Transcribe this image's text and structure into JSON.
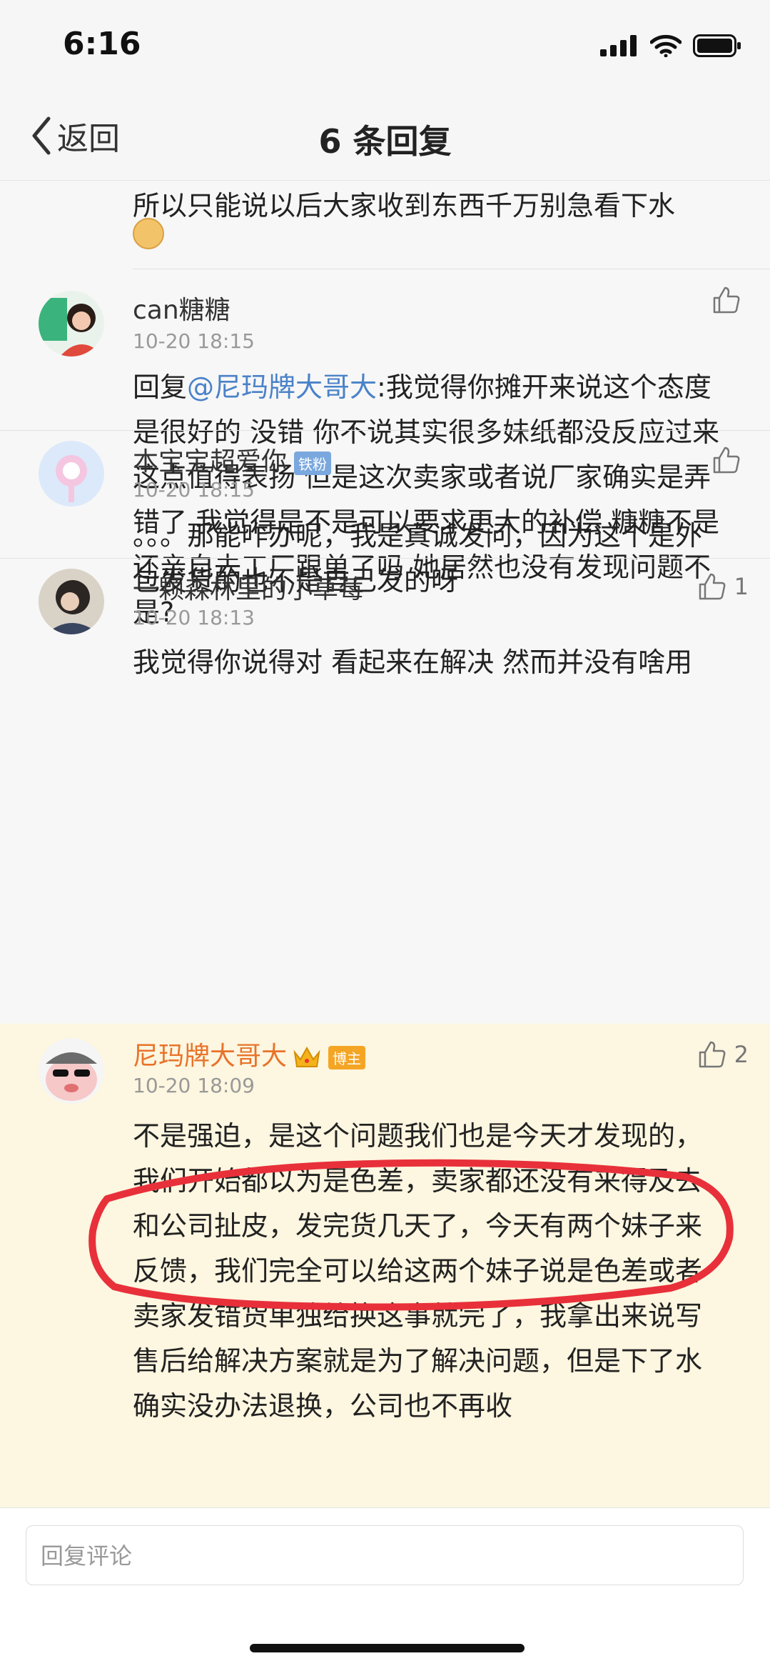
{
  "status": {
    "time": "6:16"
  },
  "nav": {
    "back_label": "返回",
    "title": "6 条回复"
  },
  "continued_text": "所以只能说以后大家收到东西千万别急看下水",
  "comments": [
    {
      "username": "can糖糖",
      "time": "10-20 18:15",
      "text_prefix": "回复",
      "mention": "@尼玛牌大哥大",
      "text": ":我觉得你摊开来说这个态度是很好的 没错 你不说其实很多妹纸都没反应过来 这点值得表扬 但是这次卖家或者说厂家确实是弄错了 我觉得是不是可以要求更大的补偿 糖糖不是还亲自去工厂跟单了吗 她居然也没有发现问题不是?",
      "likes": ""
    },
    {
      "username": "本宝宝超爱你",
      "badge": "铁粉",
      "time": "10-20 18:15",
      "text": "。。。那能咋办呢，我是真诚发问，因为这个是外包发货的也不是自己发的呀",
      "likes": ""
    },
    {
      "username": "一颗森林里的小草莓",
      "time": "10-20 18:13",
      "text": "我觉得你说得对  看起来在解决  然而并没有啥用",
      "likes": "1"
    },
    {
      "username": "尼玛牌大哥大",
      "badge": "博主",
      "time": "10-20 18:09",
      "text": "不是强迫，是这个问题我们也是今天才发现的，我们开始都以为是色差，卖家都还没有来得及去和公司扯皮，发完货几天了，今天有两个妹子来反馈，我们完全可以给这两个妹子说是色差或者卖家发错货单独给换这事就完了，我拿出来说写售后给解决方案就是为了解决问题，但是下了水确实没办法退换，公司也不再收",
      "likes": "2"
    }
  ],
  "reply": {
    "placeholder": "回复评论"
  },
  "colors": {
    "owner_name": "#e8732a",
    "mention": "#4a82c8",
    "highlight_background": "#fdf6e0",
    "annotation": "#e8303a"
  }
}
